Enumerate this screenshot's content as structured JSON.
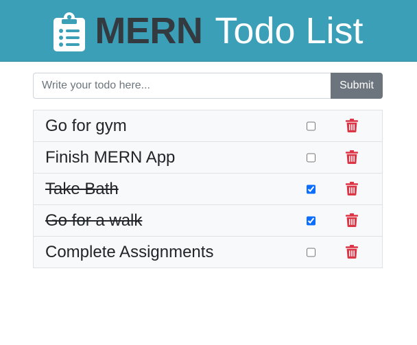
{
  "header": {
    "icon": "clipboard-list-icon",
    "title_bold": "MERN",
    "title_light": "Todo List",
    "background": "#3b9fb7"
  },
  "form": {
    "placeholder": "Write your todo here...",
    "value": "",
    "submit_label": "Submit"
  },
  "todos": [
    {
      "text": "Go for gym",
      "completed": false
    },
    {
      "text": "Finish MERN App",
      "completed": false
    },
    {
      "text": "Take Bath",
      "completed": true
    },
    {
      "text": "Go for a walk",
      "completed": true
    },
    {
      "text": "Complete Assignments",
      "completed": false
    }
  ],
  "icons": {
    "delete": "trash-icon",
    "delete_color": "#dc3545"
  }
}
